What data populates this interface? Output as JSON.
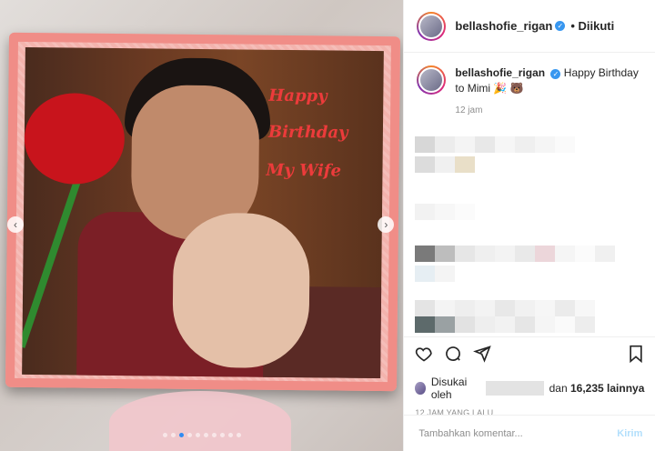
{
  "post": {
    "username": "bellashofie_rigan",
    "follow_label": "• Diikuti",
    "caption_text": "Happy Birthday to Mimi 🎉 🐻",
    "caption_time": "12 jam",
    "cake_lines": [
      "Happy",
      "Birthday",
      "My Wife"
    ],
    "likes_prefix": "Disukai oleh",
    "likes_and": "dan",
    "likes_count": "16,235",
    "likes_suffix": "lainnya",
    "date": "12 JAM YANG LALU",
    "comment_placeholder": "Tambahkan komentar...",
    "post_label": "Kirim"
  },
  "icons": {
    "like": "heart-icon",
    "comment": "comment-icon",
    "share": "share-icon",
    "save": "bookmark-icon",
    "verified": "verified-badge-icon",
    "prev": "chevron-left-icon",
    "next": "chevron-right-icon"
  },
  "colors": {
    "verified": "#3897f0",
    "carousel_active": "#2f8bf2",
    "post_button": "#b2dffc"
  },
  "carousel": {
    "total": 10,
    "active_index": 2
  }
}
